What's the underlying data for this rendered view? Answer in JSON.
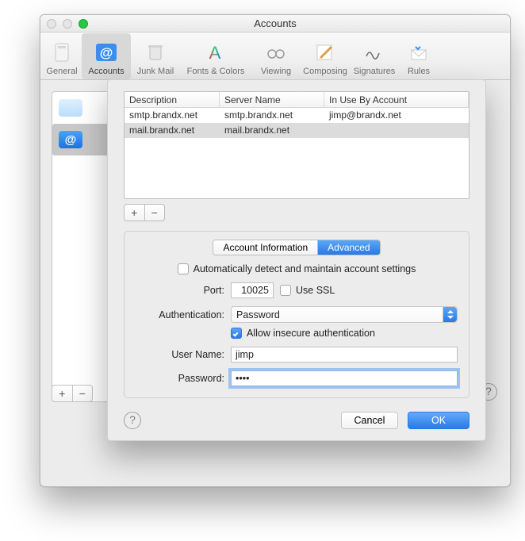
{
  "window": {
    "title": "Accounts"
  },
  "toolbar": {
    "items": [
      {
        "label": "General"
      },
      {
        "label": "Accounts"
      },
      {
        "label": "Junk Mail"
      },
      {
        "label": "Fonts & Colors"
      },
      {
        "label": "Viewing"
      },
      {
        "label": "Composing"
      },
      {
        "label": "Signatures"
      },
      {
        "label": "Rules"
      }
    ]
  },
  "sheet": {
    "columns": {
      "c1": "Description",
      "c2": "Server Name",
      "c3": "In Use By Account"
    },
    "rows": [
      {
        "desc": "smtp.brandx.net",
        "server": "smtp.brandx.net",
        "acct": "jimp@brandx.net"
      },
      {
        "desc": "mail.brandx.net",
        "server": "mail.brandx.net",
        "acct": ""
      }
    ],
    "tabs": {
      "info": "Account Information",
      "adv": "Advanced"
    },
    "auto_label": "Automatically detect and maintain account settings",
    "port_label": "Port:",
    "port_value": "10025",
    "ssl_label": "Use SSL",
    "auth_label": "Authentication:",
    "auth_value": "Password",
    "insecure_label": "Allow insecure authentication",
    "user_label": "User Name:",
    "user_value": "jimp",
    "pass_label": "Password:",
    "pass_value": "••••",
    "cancel": "Cancel",
    "ok": "OK",
    "help": "?"
  },
  "glyphs": {
    "plus": "+",
    "minus": "−",
    "at": "@",
    "help": "?"
  }
}
